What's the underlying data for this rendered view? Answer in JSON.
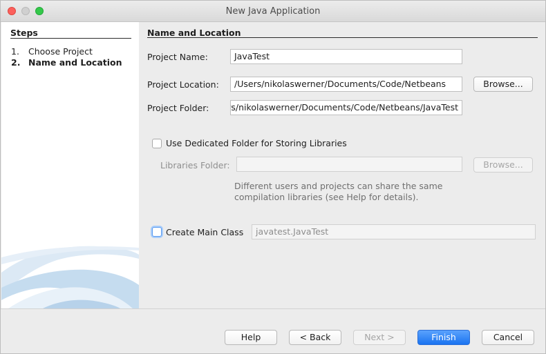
{
  "window": {
    "title": "New Java Application"
  },
  "steps": {
    "title": "Steps",
    "items": [
      {
        "num": "1.",
        "label": "Choose Project",
        "current": false
      },
      {
        "num": "2.",
        "label": "Name and Location",
        "current": true
      }
    ]
  },
  "section": {
    "title": "Name and Location"
  },
  "form": {
    "project_name_label": "Project Name:",
    "project_name_value": "JavaTest",
    "project_location_label": "Project Location:",
    "project_location_value": "/Users/nikolaswerner/Documents/Code/Netbeans",
    "project_folder_label": "Project Folder:",
    "project_folder_value": "/Users/nikolaswerner/Documents/Code/Netbeans/JavaTest",
    "browse_label": "Browse...",
    "dedicated_folder_label": "Use Dedicated Folder for Storing Libraries",
    "dedicated_folder_checked": false,
    "libraries_folder_label": "Libraries Folder:",
    "libraries_folder_value": "",
    "libraries_browse_label": "Browse...",
    "help_text": "Different users and projects can share the same compilation libraries (see Help for details).",
    "create_main_label": "Create Main Class",
    "create_main_checked": false,
    "main_class_value": "javatest.JavaTest"
  },
  "buttons": {
    "help": "Help",
    "back": "< Back",
    "next": "Next >",
    "finish": "Finish",
    "cancel": "Cancel"
  },
  "colors": {
    "primary_button": "#1a73f0",
    "close": "#fc605c",
    "maximize": "#34c84a"
  }
}
